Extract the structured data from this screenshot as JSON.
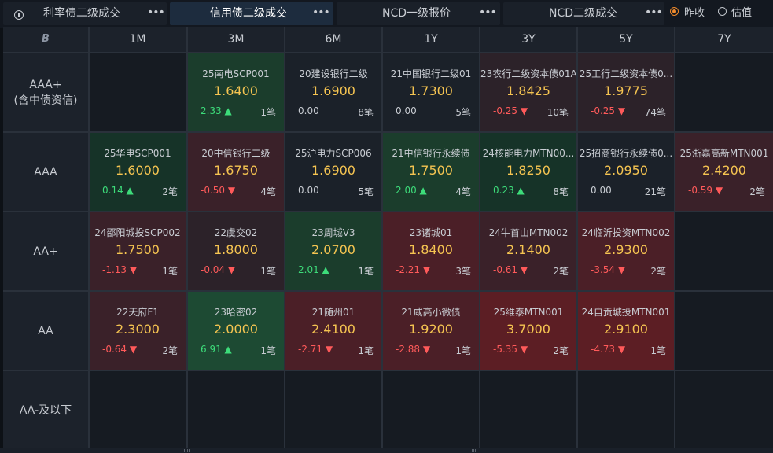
{
  "tabs": [
    {
      "label": "利率债二级成交",
      "more": "•••"
    },
    {
      "label": "信用债二级成交",
      "more": "•••"
    },
    {
      "label": "NCD一级报价",
      "more": "•••"
    },
    {
      "label": "NCD二级成交",
      "more": "•••"
    }
  ],
  "options": {
    "prev_close": "昨收",
    "valuation": "估值",
    "selected": "prev_close"
  },
  "corner": "B",
  "columns": [
    "1M",
    "3M",
    "6M",
    "1Y",
    "3Y",
    "5Y",
    "7Y"
  ],
  "rows": [
    {
      "label": "AAA+\n(含中债资信)",
      "cells": [
        null,
        {
          "name": "25南电SCP001",
          "yield": "1.6400",
          "change": "2.33",
          "dir": "up",
          "count": "1笔"
        },
        {
          "name": "20建设银行二级",
          "yield": "1.6900",
          "change": "0.00",
          "dir": "flat",
          "count": "8笔"
        },
        {
          "name": "21中国银行二级01",
          "yield": "1.7300",
          "change": "0.00",
          "dir": "flat",
          "count": "5笔"
        },
        {
          "name": "23农行二级资本债01A",
          "yield": "1.8425",
          "change": "-0.25",
          "dir": "down",
          "count": "10笔"
        },
        {
          "name": "25工行二级资本债0...",
          "yield": "1.9775",
          "change": "-0.25",
          "dir": "down",
          "count": "74笔"
        },
        null
      ]
    },
    {
      "label": "AAA",
      "cells": [
        {
          "name": "25华电SCP001",
          "yield": "1.6000",
          "change": "0.14",
          "dir": "up",
          "count": "2笔"
        },
        {
          "name": "20中信银行二级",
          "yield": "1.6750",
          "change": "-0.50",
          "dir": "down",
          "count": "4笔"
        },
        {
          "name": "25沪电力SCP006",
          "yield": "1.6900",
          "change": "0.00",
          "dir": "flat",
          "count": "5笔"
        },
        {
          "name": "21中信银行永续债",
          "yield": "1.7500",
          "change": "2.00",
          "dir": "up",
          "count": "4笔"
        },
        {
          "name": "24核能电力MTN00...",
          "yield": "1.8250",
          "change": "0.23",
          "dir": "up",
          "count": "8笔"
        },
        {
          "name": "25招商银行永续债0...",
          "yield": "2.0950",
          "change": "0.00",
          "dir": "flat",
          "count": "21笔"
        },
        {
          "name": "25浙嘉高新MTN001",
          "yield": "2.4200",
          "change": "-0.59",
          "dir": "down",
          "count": "2笔"
        }
      ]
    },
    {
      "label": "AA+",
      "cells": [
        {
          "name": "24邵阳城投SCP002",
          "yield": "1.7500",
          "change": "-1.13",
          "dir": "down",
          "count": "1笔"
        },
        {
          "name": "22虞交02",
          "yield": "1.8000",
          "change": "-0.04",
          "dir": "down",
          "count": "1笔"
        },
        {
          "name": "23周城V3",
          "yield": "2.0700",
          "change": "2.01",
          "dir": "up",
          "count": "1笔"
        },
        {
          "name": "23诸城01",
          "yield": "1.8400",
          "change": "-2.21",
          "dir": "down",
          "count": "3笔"
        },
        {
          "name": "24牛首山MTN002",
          "yield": "2.1400",
          "change": "-0.61",
          "dir": "down",
          "count": "2笔"
        },
        {
          "name": "24临沂投资MTN002",
          "yield": "2.9300",
          "change": "-3.54",
          "dir": "down",
          "count": "2笔"
        },
        null
      ]
    },
    {
      "label": "AA",
      "cells": [
        {
          "name": "22天府F1",
          "yield": "2.3000",
          "change": "-0.64",
          "dir": "down",
          "count": "2笔"
        },
        {
          "name": "23哈密02",
          "yield": "2.0000",
          "change": "6.91",
          "dir": "up",
          "count": "1笔"
        },
        {
          "name": "21随州01",
          "yield": "2.4100",
          "change": "-2.71",
          "dir": "down",
          "count": "1笔"
        },
        {
          "name": "21咸高小微债",
          "yield": "1.9200",
          "change": "-2.88",
          "dir": "down",
          "count": "1笔"
        },
        {
          "name": "25维泰MTN001",
          "yield": "3.7000",
          "change": "-5.35",
          "dir": "down",
          "count": "2笔"
        },
        {
          "name": "24自贡城投MTN001",
          "yield": "2.9100",
          "change": "-4.73",
          "dir": "down",
          "count": "1笔"
        },
        null
      ]
    },
    {
      "label": "AA-及以下",
      "cells": [
        null,
        null,
        null,
        null,
        null,
        null,
        null
      ]
    }
  ],
  "colors": {
    "up": "#3ddc7a",
    "down": "#ff5a5a",
    "yield": "#f5c451",
    "empty": "#161b22",
    "heat_up": [
      "#163328",
      "#1b3d2c",
      "#1d4a33"
    ],
    "heat_down": [
      "#2c2229",
      "#3a2129",
      "#4b1f27",
      "#5c1e24"
    ]
  }
}
